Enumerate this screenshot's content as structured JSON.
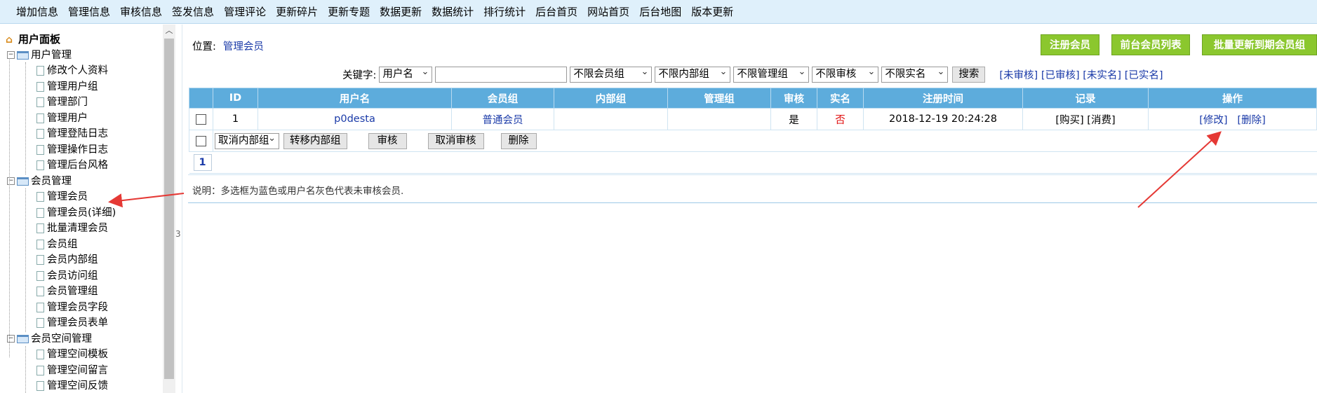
{
  "top_menu": [
    "增加信息",
    "管理信息",
    "审核信息",
    "签发信息",
    "管理评论",
    "更新碎片",
    "更新专题",
    "数据更新",
    "数据统计",
    "排行统计",
    "后台首页",
    "网站首页",
    "后台地图",
    "版本更新"
  ],
  "sidebar": {
    "root": "用户面板",
    "groups": [
      {
        "label": "用户管理",
        "items": [
          "修改个人资料",
          "管理用户组",
          "管理部门",
          "管理用户",
          "管理登陆日志",
          "管理操作日志",
          "管理后台风格"
        ]
      },
      {
        "label": "会员管理",
        "items": [
          "管理会员",
          "管理会员(详细)",
          "批量清理会员",
          "会员组",
          "会员内部组",
          "会员访问组",
          "会员管理组",
          "管理会员字段",
          "管理会员表单"
        ]
      },
      {
        "label": "会员空间管理",
        "items": [
          "管理空间模板",
          "管理空间留言",
          "管理空间反馈"
        ]
      }
    ],
    "splitter_label": "3"
  },
  "location": {
    "label": "位置:",
    "link": "管理会员"
  },
  "actions": {
    "register": "注册会员",
    "list": "前台会员列表",
    "batch": "批量更新到期会员组"
  },
  "filter": {
    "keyword_label": "关键字:",
    "field_select": "用户名",
    "keyword_value": "",
    "group_select": "不限会员组",
    "inner_select": "不限内部组",
    "admin_select": "不限管理组",
    "check_select": "不限审核",
    "real_select": "不限实名",
    "search_button": "搜索",
    "links": [
      "[未审核]",
      "[已审核]",
      "[未实名]",
      "[已实名]"
    ]
  },
  "table": {
    "headers": [
      "ID",
      "用户名",
      "会员组",
      "内部组",
      "管理组",
      "审核",
      "实名",
      "注册时间",
      "记录",
      "操作"
    ],
    "rows": [
      {
        "id": "1",
        "username": "p0desta",
        "group": "普通会员",
        "inner": "",
        "admin": "",
        "checked": "是",
        "real": "否",
        "regtime": "2018-12-19 20:24:28",
        "record_buy": "[购买]",
        "record_spend": "[消费]",
        "op_edit": "[修改]",
        "op_delete": "[删除]"
      }
    ]
  },
  "bulk": {
    "inner_select": "取消内部组",
    "move": "转移内部组",
    "check": "审核",
    "uncheck": "取消审核",
    "delete": "删除"
  },
  "pager": {
    "current": "1"
  },
  "note": "说明：多选框为蓝色或用户名灰色代表未审核会员.",
  "colors": {
    "header_bg": "#5dacdc",
    "green_button": "#8bc72e",
    "link": "#1a3aa8",
    "annotation_arrow": "#e53935"
  }
}
